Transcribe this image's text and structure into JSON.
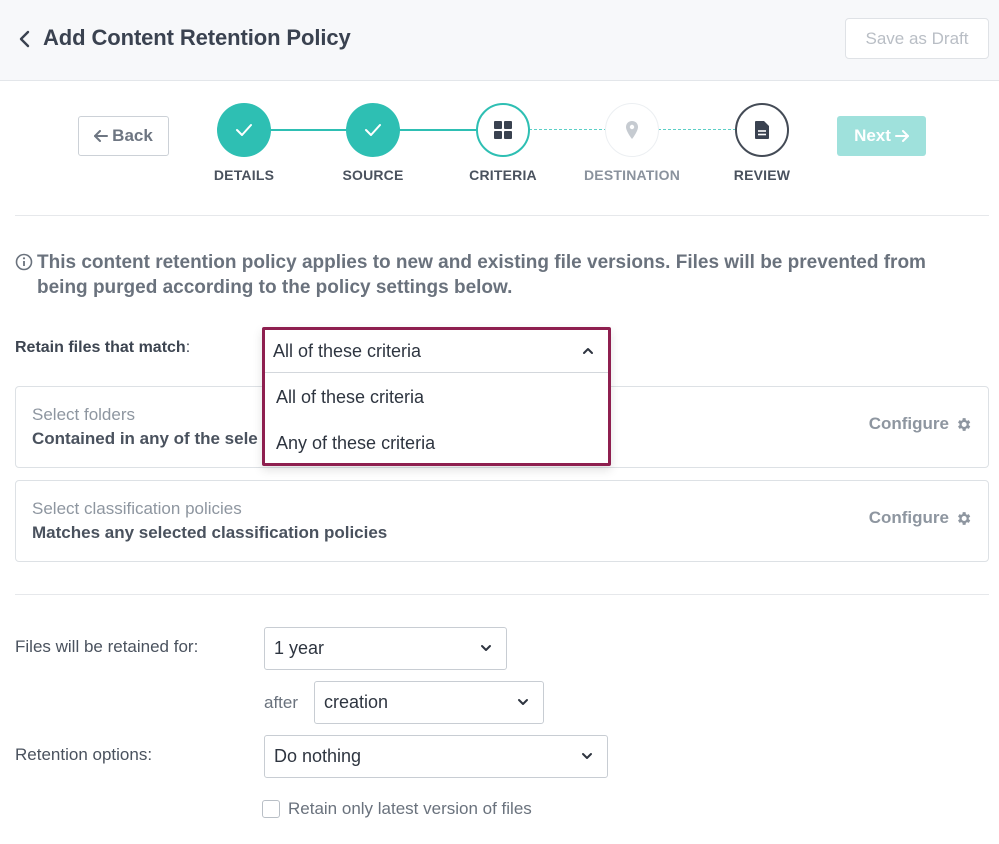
{
  "header": {
    "title": "Add Content Retention Policy",
    "save_draft_label": "Save as Draft"
  },
  "wizard": {
    "back_label": "Back",
    "next_label": "Next",
    "steps": [
      {
        "label": "DETAILS",
        "state": "done"
      },
      {
        "label": "SOURCE",
        "state": "done"
      },
      {
        "label": "CRITERIA",
        "state": "current"
      },
      {
        "label": "DESTINATION",
        "state": "pending"
      },
      {
        "label": "REVIEW",
        "state": "pending"
      }
    ]
  },
  "info": {
    "text": "This content retention policy applies to new and existing file versions. Files will be prevented from being purged according to the policy settings below."
  },
  "criteria": {
    "retain_label": "Retain files that match",
    "retain_colon": ":",
    "match_dropdown": {
      "selected": "All of these criteria",
      "options": [
        "All of these criteria",
        "Any of these criteria"
      ],
      "open": true
    },
    "cards": [
      {
        "title": "Select folders",
        "subtitle": "Contained in any of the sele",
        "action": "Configure"
      },
      {
        "title": "Select classification policies",
        "subtitle": "Matches any selected classification policies",
        "action": "Configure"
      }
    ]
  },
  "retention": {
    "period_label": "Files will be retained for:",
    "period_value": "1 year",
    "after_label": "after",
    "after_value": "creation",
    "options_label": "Retention options:",
    "options_value": "Do nothing",
    "latest_only_label": "Retain only latest version of files",
    "latest_only_checked": false
  },
  "colors": {
    "teal": "#2ebfb3",
    "teal_light": "#9fe1dc",
    "dropdown_highlight": "#8e1f4f"
  },
  "icons": {
    "back_chevron": "chevron-left-icon",
    "check": "check-icon",
    "grid": "grid-icon",
    "location": "map-pin-icon",
    "document": "document-icon",
    "info": "info-icon",
    "gear": "gear-icon",
    "arrow_left": "arrow-left-icon",
    "arrow_right": "arrow-right-icon",
    "chevron_down": "chevron-down-icon",
    "chevron_up": "chevron-up-icon"
  }
}
